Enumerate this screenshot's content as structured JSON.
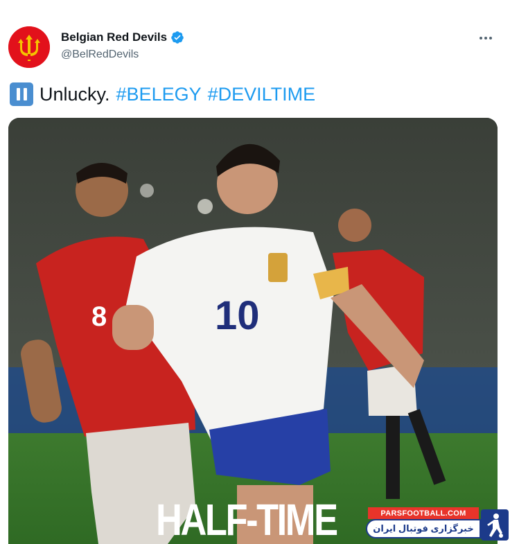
{
  "author": {
    "display_name": "Belgian Red Devils",
    "handle": "@BelRedDevils",
    "verified": true,
    "avatar_icon": "trident-icon",
    "avatar_color": "#e2111b"
  },
  "tweet": {
    "emoji_icon": "pause-button-icon",
    "text": "Unlucky.",
    "hashtags": [
      "#BELEGY",
      "#DEVILTIME"
    ]
  },
  "media": {
    "overlay_text": "HALF-TIME",
    "players": {
      "belgium_number": "10",
      "egypt_number": "8"
    },
    "watermark": {
      "top_text": "PARSFOOTBALL.COM",
      "bottom_text": "خبرگزاری فوتبال ایران"
    }
  },
  "colors": {
    "hashtag": "#1d9bf0",
    "verified_badge": "#1d9bf0",
    "secondary_text": "#536471"
  }
}
